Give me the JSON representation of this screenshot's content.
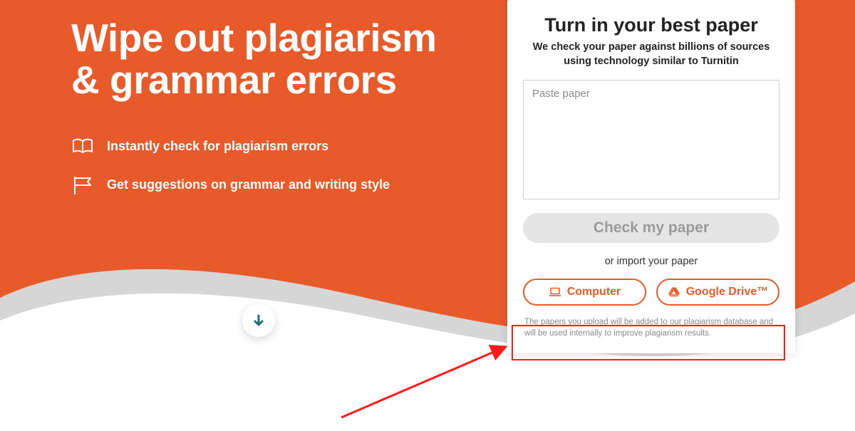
{
  "hero": {
    "headline": "Wipe out plagiarism & grammar errors",
    "bullets": [
      {
        "icon": "book-open-icon",
        "text": "Instantly check for plagiarism errors"
      },
      {
        "icon": "flag-icon",
        "text": "Get suggestions on grammar and writing style"
      }
    ]
  },
  "panel": {
    "title": "Turn in your best paper",
    "subtitle": "We check your paper against billions of sources using technology similar to Turnitin",
    "textarea_placeholder": "Paste paper",
    "check_label": "Check my paper",
    "or_import": "or import your paper",
    "import_computer": "Computer",
    "import_gdrive": "Google Drive™",
    "disclaimer": "The papers you upload will be added to our plagiarism database and will be used internally to improve plagiarism results."
  },
  "colors": {
    "accent": "#e85a2a",
    "gray_curve": "#d6d6d6",
    "teal": "#1f6f7b",
    "alert_red": "#ff1a1a"
  }
}
